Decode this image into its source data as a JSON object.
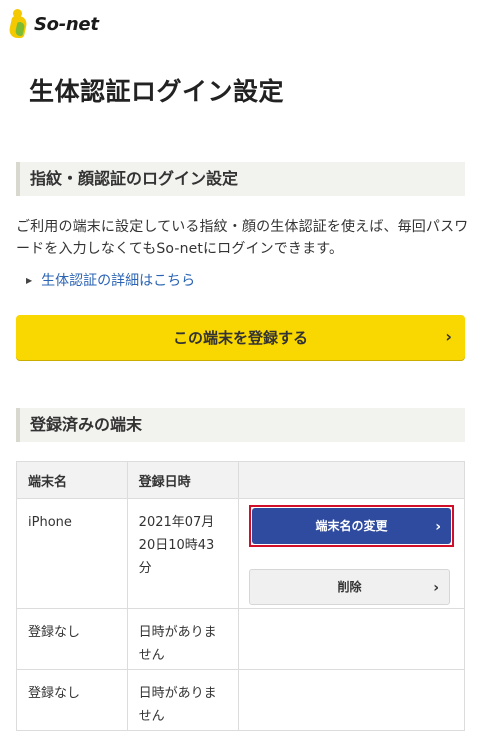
{
  "brand": {
    "name": "So-net",
    "accent": "#f9d700",
    "link_color": "#2b64b4",
    "primary_button": "#2f4b9f"
  },
  "page": {
    "title": "生体認証ログイン設定"
  },
  "section_fingerprint": {
    "heading": "指紋・顔認証のログイン設定",
    "description": "ご利用の端末に設定している指紋・顔の生体認証を使えば、毎回パスワードを入力しなくてもSo-netにログインできます。",
    "detail_link": "生体認証の詳細はこちら",
    "register_button": "この端末を登録する",
    "register_icon": "chevron-right-icon"
  },
  "section_devices": {
    "heading": "登録済みの端末",
    "columns": [
      "端末名",
      "登録日時",
      ""
    ],
    "rows": [
      {
        "name": "iPhone",
        "date": "2021年07月20日10時43分",
        "change_label": "端末名の変更",
        "delete_label": "削除"
      },
      {
        "name": "登録なし",
        "date": "日時がありません"
      },
      {
        "name": "登録なし",
        "date": "日時がありません"
      }
    ]
  }
}
